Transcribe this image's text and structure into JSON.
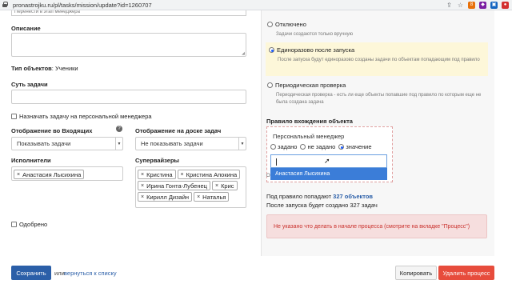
{
  "browser": {
    "url": "pronastrojku.ru/pl/tasks/mission/update?id=1260707",
    "icons": [
      {
        "name": "share-icon",
        "glyph": "⇪",
        "color": "#5f6368"
      },
      {
        "name": "star-icon",
        "glyph": "☆",
        "color": "#5f6368"
      },
      {
        "name": "extension-icon-1",
        "glyph": "8",
        "color": "#e8710a"
      },
      {
        "name": "extension-icon-2",
        "glyph": "◆",
        "color": "#7b1fa2"
      },
      {
        "name": "extension-icon-3",
        "glyph": "▣",
        "color": "#1565c0"
      },
      {
        "name": "extension-icon-4",
        "glyph": "●",
        "color": "#d32f2f"
      }
    ]
  },
  "form": {
    "top_field_partial": "Перенести в этап менеджера",
    "description_label": "Описание",
    "object_type_label": "Тип объектов",
    "object_type_value": ": Ученики",
    "task_essence_label": "Суть задачи",
    "assign_manager_label": "Назначать задачу на персональной менеджера",
    "inbox_display_label": "Отображение во Входящих",
    "inbox_display_value": "Показывать задачи",
    "board_display_label": "Отображение на доске задач",
    "board_display_value": "Не показывать задачи",
    "help_glyph": "?",
    "executors_label": "Исполнители",
    "executors": [
      "Анастасия Лысихина"
    ],
    "supervisors_label": "Супервайзеры",
    "supervisors": [
      "Кристина",
      "Кристина Апокина",
      "Ирина Гонта-Лубенец",
      "Крис",
      "Кирилл Дизайн",
      "Наталья"
    ],
    "approved_label": "Одобрено",
    "tag_remove_glyph": "×",
    "caret_glyph": "▼"
  },
  "panel": {
    "options": [
      {
        "title": "Отключено",
        "desc": "Задачи создаются только вручную",
        "selected": false
      },
      {
        "title": "Единоразово после запуска",
        "desc": "После запуска будут единоразово созданы задачи по объектам попадающим под правило",
        "selected": true
      },
      {
        "title": "Периодическая проверка",
        "desc": "Периодическая проверка - есть ли еще объекты попавшие под правило по которым еще не была создана задача",
        "selected": false
      }
    ],
    "rule_title": "Правило вхождения объекта",
    "rule_field": "Персональный менеджер",
    "rule_radios": [
      {
        "label": "задано",
        "selected": false
      },
      {
        "label": "не задано",
        "selected": false
      },
      {
        "label": "значение",
        "selected": true
      }
    ],
    "rule_cut_text": "О",
    "dropdown_option": "Анастасия Лысихина",
    "stats_line1_prefix": "Под правило попадают ",
    "stats_line1_value": "327 объектов",
    "stats_line2": "После запуска будет создано 327 задач",
    "warning": "Не указано что делать в начале процесса (смотрите на вкладке \"Процесс\")"
  },
  "footer": {
    "save": "Сохранить",
    "or": "или",
    "back_link": "вернуться к списку",
    "copy": "Копировать",
    "delete": "Удалить процесс"
  },
  "colors": {
    "primary": "#2b5fa8",
    "selected_option_bg": "#fdf7d9",
    "warning_bg": "#f6dede",
    "warning_text": "#c9302c",
    "delete_bg": "#e74c3c",
    "dropdown_highlight": "#3b7dd8",
    "stats_accent": "#2b5fa8"
  }
}
